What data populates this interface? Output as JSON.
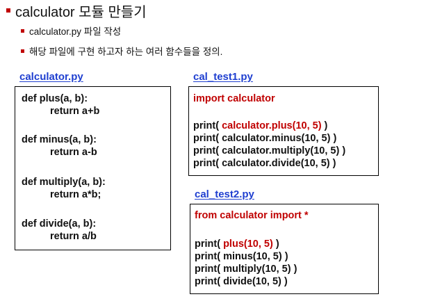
{
  "heading": {
    "title": "calculator 모듈 만들기",
    "bullets": [
      "calculator.py 파일 작성",
      "해당 파일에 구현 하고자 하는 여러 함수들을 정의."
    ]
  },
  "calculator_py": {
    "label": "calculator.py",
    "lines": [
      "def  plus(a, b):",
      "return a+b",
      "def  minus(a, b):",
      "return a-b",
      "def  multiply(a, b):",
      "return a*b;",
      "def  divide(a, b):",
      "return a/b"
    ]
  },
  "cal_test1": {
    "label": "cal_test1.py",
    "import_line": "import  calculator",
    "print_prefix": "print( ",
    "line1_call": "calculator.plus(10, 5)",
    "line2_call": "calculator.minus(10, 5)",
    "line3_call": "calculator.multiply(10, 5)",
    "line4_call": "calculator.divide(10, 5)",
    "close": " )"
  },
  "cal_test2": {
    "label": "cal_test2.py",
    "import_line": "from calculator import *",
    "print_prefix": "print( ",
    "line1_call": "plus(10, 5)",
    "line2_call": "minus(10, 5)",
    "line3_call": "multiply(10, 5)",
    "line4_call": "divide(10, 5)",
    "close": " )"
  },
  "colors": {
    "accent_red": "#c00000",
    "label_blue": "#1f3fd0"
  }
}
